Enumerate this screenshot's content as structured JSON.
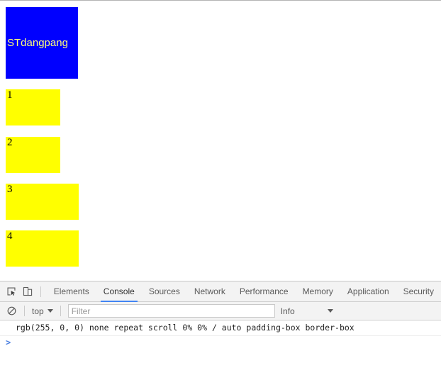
{
  "page": {
    "blue_box": {
      "label": "STdangpang",
      "bg_color": "#0000ff",
      "text_color": "#ffff7a"
    },
    "yellow_boxes": [
      {
        "label": "1",
        "bg_color": "#ffff00"
      },
      {
        "label": "2",
        "bg_color": "#ffff00"
      },
      {
        "label": "3",
        "bg_color": "#ffff00"
      },
      {
        "label": "4",
        "bg_color": "#ffff00"
      }
    ]
  },
  "devtools": {
    "toolbar": {
      "inspect_icon": "inspect-element-icon",
      "device_icon": "device-toolbar-icon",
      "tabs": [
        {
          "label": "Elements",
          "active": false
        },
        {
          "label": "Console",
          "active": true
        },
        {
          "label": "Sources",
          "active": false
        },
        {
          "label": "Network",
          "active": false
        },
        {
          "label": "Performance",
          "active": false
        },
        {
          "label": "Memory",
          "active": false
        },
        {
          "label": "Application",
          "active": false
        },
        {
          "label": "Security",
          "active": false
        }
      ],
      "active_tab_color": "#4285f4"
    },
    "filterbar": {
      "clear_icon": "clear-console-icon",
      "context": "top",
      "filter_placeholder": "Filter",
      "filter_value": "",
      "level": "Info"
    },
    "console": {
      "messages": [
        "rgb(255, 0, 0) none repeat scroll 0% 0% / auto padding-box border-box"
      ],
      "prompt": ">"
    }
  }
}
